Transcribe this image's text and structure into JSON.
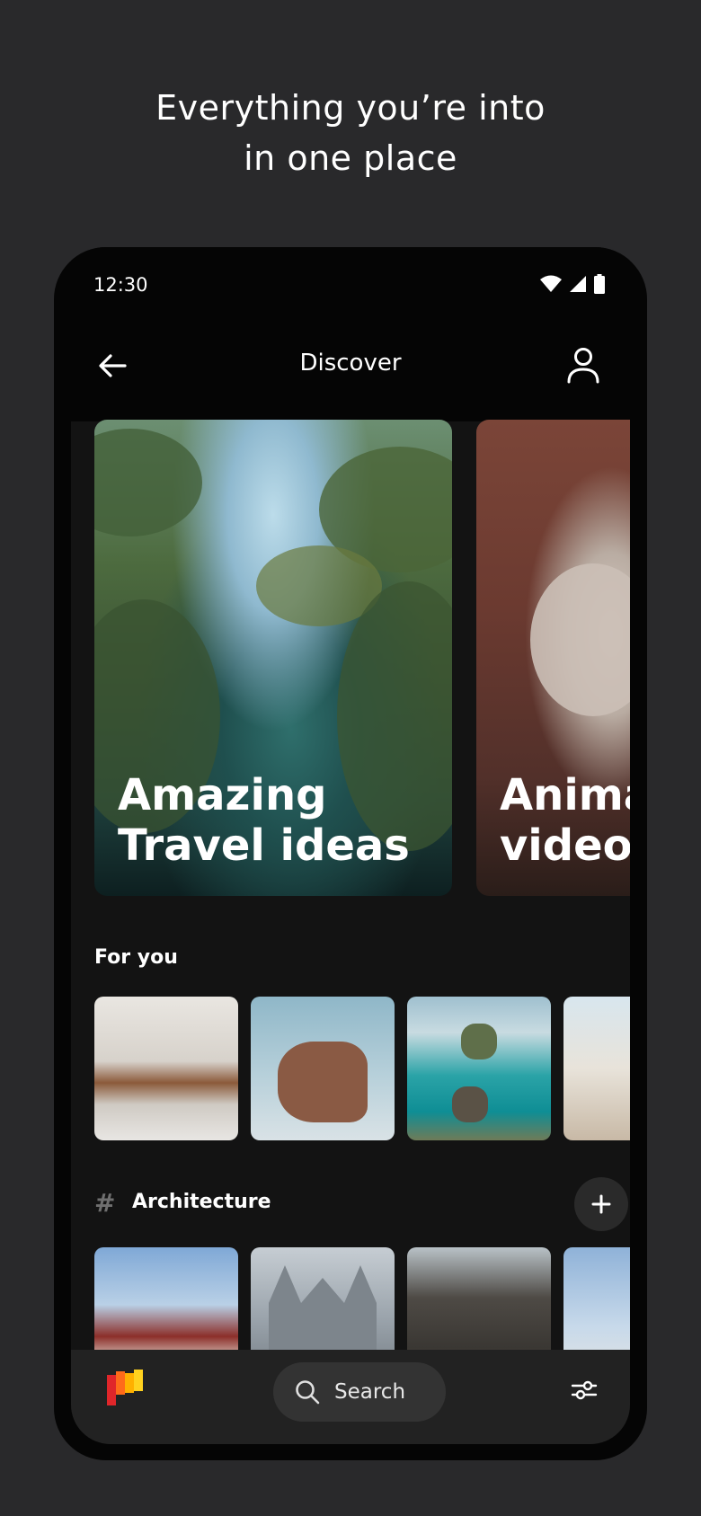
{
  "headline": {
    "line1": "Everything you’re into",
    "line2": "in one place"
  },
  "status": {
    "time": "12:30",
    "icons": [
      "wifi-icon",
      "signal-icon",
      "battery-icon"
    ]
  },
  "topbar": {
    "title": "Discover",
    "back_icon": "arrow-left-icon",
    "profile_icon": "person-icon"
  },
  "cards": [
    {
      "line1": "Amazing",
      "line2": "Travel ideas"
    },
    {
      "line1": "Anima",
      "line2": "videos"
    }
  ],
  "for_you": {
    "label": "For you"
  },
  "architecture": {
    "hash": "#",
    "label": "Architecture",
    "add_icon": "plus-icon"
  },
  "bottom_nav": {
    "logo_icon": "app-logo-icon",
    "search_label": "Search",
    "search_icon": "search-icon",
    "filter_icon": "sliders-icon"
  },
  "colors": {
    "background": "#29292b",
    "phone": "#050505",
    "screen": "#131313",
    "bottom_bar": "#222222",
    "pill": "#333333"
  }
}
